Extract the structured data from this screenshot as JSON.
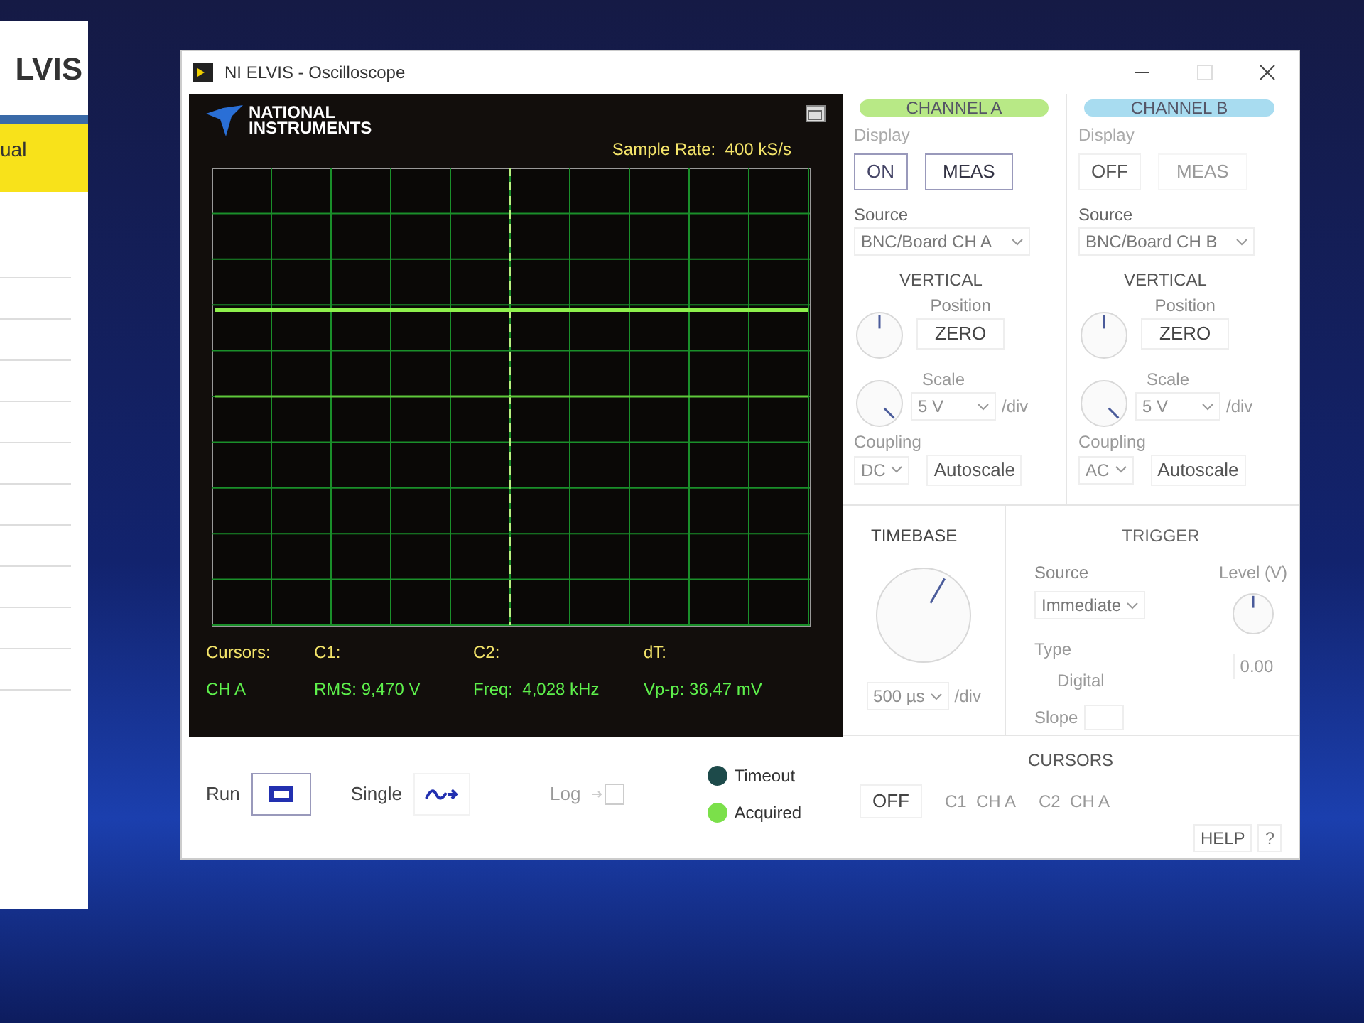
{
  "background_window": {
    "title": "LVIS",
    "banner": "ual"
  },
  "window": {
    "title": "NI ELVIS - Oscilloscope"
  },
  "scope": {
    "logo": [
      "NATIONAL",
      "INSTRUMENTS"
    ],
    "sample_rate": "Sample Rate:  400 kS/s",
    "readouts": [
      {
        "label": "Cursors:",
        "value": "CH A"
      },
      {
        "label": "C1:",
        "value": "RMS: 9,470 V"
      },
      {
        "label": "C2:",
        "value": "Freq:  4,028 kHz"
      },
      {
        "label": "dT:",
        "value": "Vp-p: 36,47 mV"
      }
    ]
  },
  "channels": [
    {
      "title": "CHANNEL A",
      "color": "#b8e986",
      "display_label": "Display",
      "display": "ON",
      "display_on": true,
      "meas": "MEAS",
      "meas_disabled": false,
      "source_label": "Source",
      "source": "BNC/Board CH A",
      "vertical": "VERTICAL",
      "position": "Position",
      "zero": "ZERO",
      "scale_label": "Scale",
      "scale": "5 V",
      "per_div": "/div",
      "coupling_label": "Coupling",
      "coupling": "DC",
      "autoscale": "Autoscale"
    },
    {
      "title": "CHANNEL B",
      "color": "#a8dcf0",
      "display_label": "Display",
      "display": "OFF",
      "display_on": false,
      "meas": "MEAS",
      "meas_disabled": true,
      "source_label": "Source",
      "source": "BNC/Board CH B",
      "vertical": "VERTICAL",
      "position": "Position",
      "zero": "ZERO",
      "scale_label": "Scale",
      "scale": "5 V",
      "per_div": "/div",
      "coupling_label": "Coupling",
      "coupling": "AC",
      "autoscale": "Autoscale"
    }
  ],
  "timebase": {
    "title": "TIMEBASE",
    "value": "500 µs",
    "per_div": "/div"
  },
  "trigger": {
    "title": "TRIGGER",
    "source_label": "Source",
    "source": "Immediate",
    "level_label": "Level (V)",
    "type_label": "Type",
    "type": "Digital",
    "level": "0.00",
    "slope_label": "Slope"
  },
  "cursors": {
    "title": "CURSORS",
    "toggle": "OFF",
    "c1": "C1  CH A",
    "c2": "C2  CH A"
  },
  "controls": {
    "run": "Run",
    "single": "Single",
    "log": "Log",
    "log_disabled": true
  },
  "indicators": [
    {
      "label": "Timeout",
      "on": false
    },
    {
      "label": "Acquired",
      "on": true
    }
  ],
  "help": [
    "HELP",
    "?"
  ]
}
